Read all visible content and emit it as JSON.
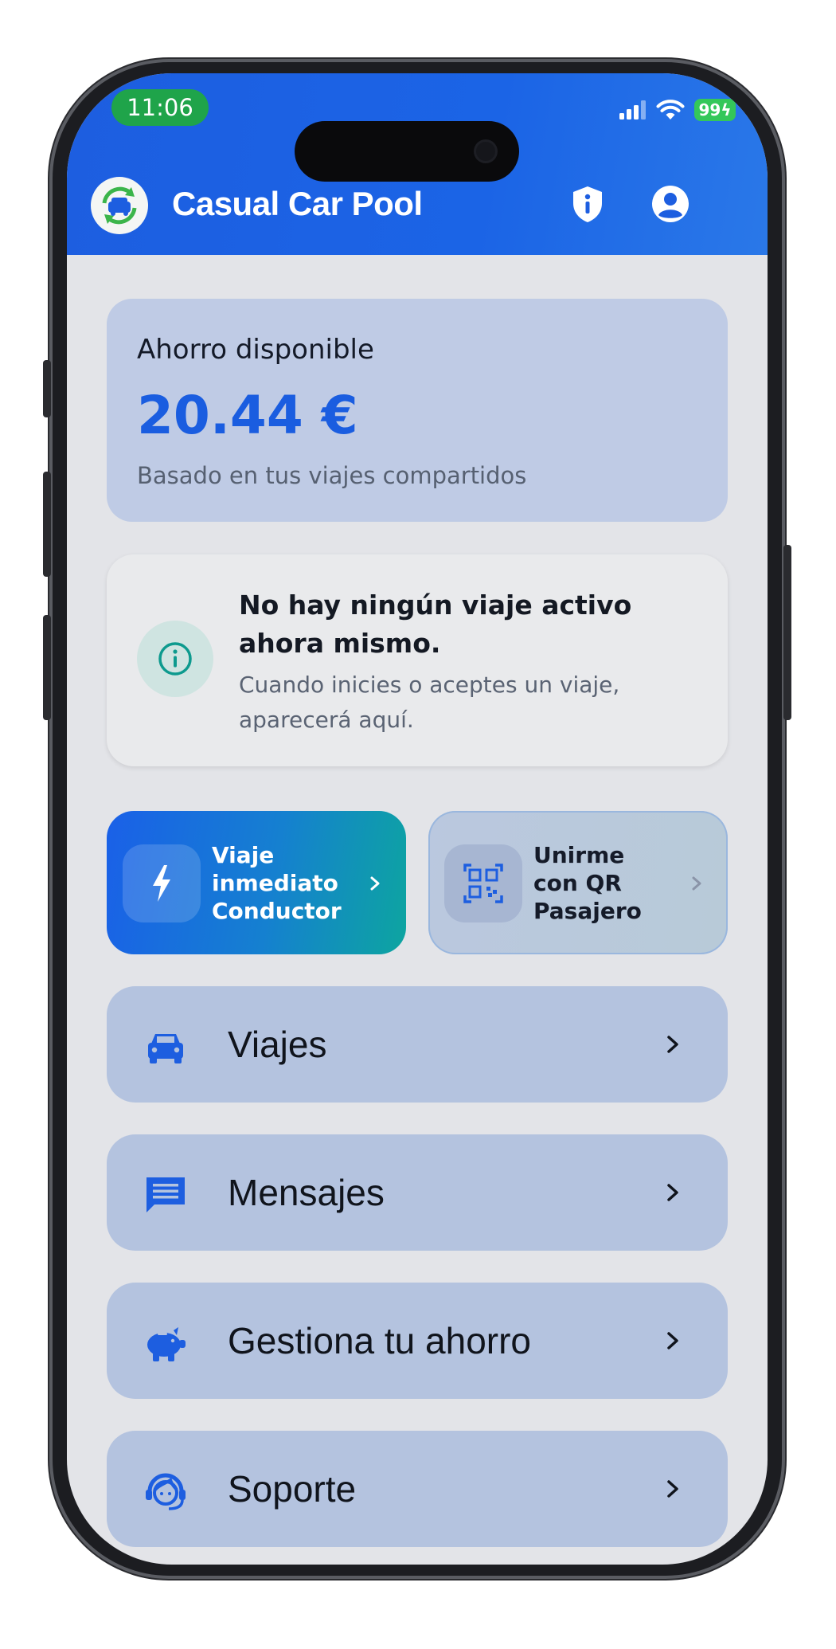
{
  "status_bar": {
    "time": "11:06",
    "battery": "99"
  },
  "header": {
    "app_title": "Casual Car Pool"
  },
  "savings": {
    "label": "Ahorro disponible",
    "value": "20.44 €",
    "subtitle": "Basado en tus viajes compartidos"
  },
  "info": {
    "title": "No hay ningún viaje activo ahora mismo.",
    "subtitle": "Cuando inicies o aceptes un viaje, aparecerá aquí."
  },
  "actions": [
    {
      "label_lines": [
        "Viaje",
        "inmediato",
        "Conductor"
      ],
      "icon": "lightning-icon"
    },
    {
      "label_lines": [
        "Unirme",
        "con QR",
        "Pasajero"
      ],
      "icon": "qr-code-icon"
    }
  ],
  "menu": [
    {
      "label": "Viajes",
      "icon": "car-icon"
    },
    {
      "label": "Mensajes",
      "icon": "message-icon"
    },
    {
      "label": "Gestiona tu ahorro",
      "icon": "piggy-bank-icon"
    },
    {
      "label": "Soporte",
      "icon": "support-agent-icon"
    }
  ],
  "colors": {
    "brand_blue": "#1b64e6",
    "accent_teal": "#0da5a0",
    "card_blue": "#bfcbe5",
    "menu_blue": "#b4c3df"
  }
}
